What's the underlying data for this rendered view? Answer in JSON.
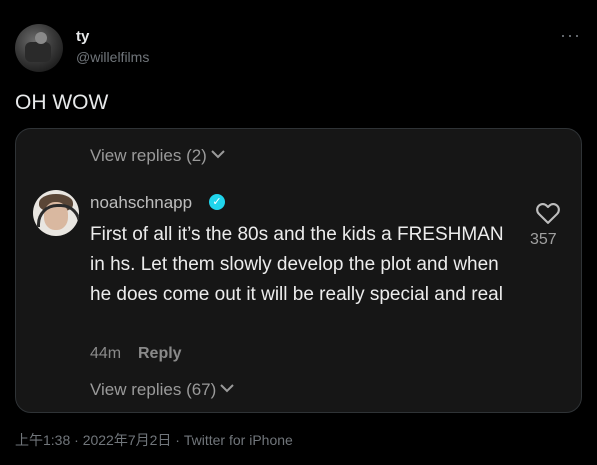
{
  "tweet": {
    "display_name": "ty",
    "handle": "@willelfilms",
    "more_icon": "more-icon",
    "text": "OH WOW"
  },
  "embedded_comment": {
    "view_replies_top": "View replies (2)",
    "username": "noahschnapp",
    "verified_icon": "verified-badge-icon",
    "body": "First of all it’s the 80s and the kids a FRESHMAN in hs. Let them slowly develop the plot and when he does come out it will be really special and real",
    "time": "44m",
    "reply_label": "Reply",
    "like_icon": "heart-icon",
    "like_count": "357",
    "view_replies_bottom": "View replies (67)"
  },
  "meta": {
    "time_date": "上午1:38 · 2022年7月2日 · ",
    "source": "Twitter for iPhone"
  },
  "colors": {
    "background": "#000000",
    "primary_text": "#e7e9ea",
    "secondary_text": "#71767b",
    "verified": "#20d5ec"
  }
}
